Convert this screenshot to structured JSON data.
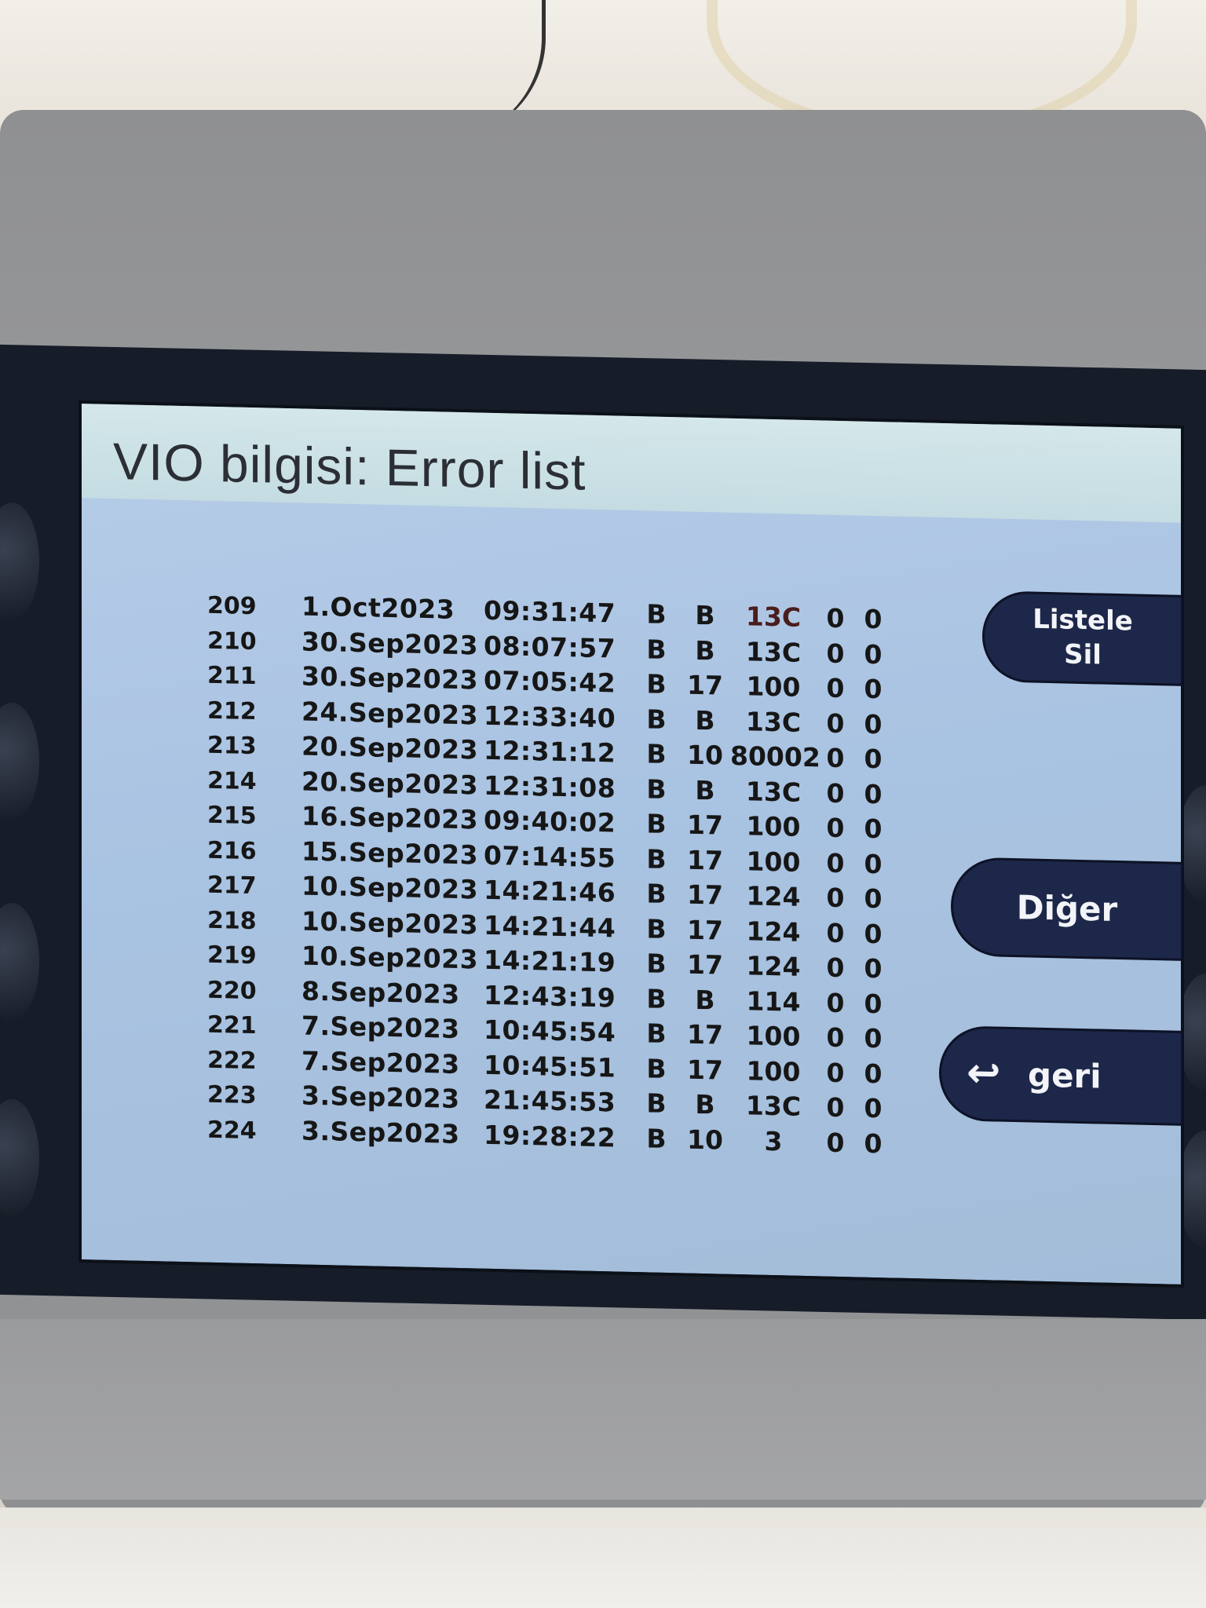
{
  "screen": {
    "title": "VIO bilgisi: Error list"
  },
  "softkeys": {
    "clear_list_line1": "Listele",
    "clear_list_line2": "Sil",
    "other": "Diğer",
    "back": "geri",
    "back_icon": "return-arrow-icon"
  },
  "error_list": {
    "rows": [
      {
        "num": "209",
        "date": "1.Oct2023",
        "time": "09:31:47",
        "f1": "B",
        "f2": "B",
        "f3": "13C",
        "f4": "0",
        "f5": "0"
      },
      {
        "num": "210",
        "date": "30.Sep2023",
        "time": "08:07:57",
        "f1": "B",
        "f2": "B",
        "f3": "13C",
        "f4": "0",
        "f5": "0"
      },
      {
        "num": "211",
        "date": "30.Sep2023",
        "time": "07:05:42",
        "f1": "B",
        "f2": "17",
        "f3": "100",
        "f4": "0",
        "f5": "0"
      },
      {
        "num": "212",
        "date": "24.Sep2023",
        "time": "12:33:40",
        "f1": "B",
        "f2": "B",
        "f3": "13C",
        "f4": "0",
        "f5": "0"
      },
      {
        "num": "213",
        "date": "20.Sep2023",
        "time": "12:31:12",
        "f1": "B",
        "f2": "10",
        "f3": "80002",
        "f4": "0",
        "f5": "0"
      },
      {
        "num": "214",
        "date": "20.Sep2023",
        "time": "12:31:08",
        "f1": "B",
        "f2": "B",
        "f3": "13C",
        "f4": "0",
        "f5": "0"
      },
      {
        "num": "215",
        "date": "16.Sep2023",
        "time": "09:40:02",
        "f1": "B",
        "f2": "17",
        "f3": "100",
        "f4": "0",
        "f5": "0"
      },
      {
        "num": "216",
        "date": "15.Sep2023",
        "time": "07:14:55",
        "f1": "B",
        "f2": "17",
        "f3": "100",
        "f4": "0",
        "f5": "0"
      },
      {
        "num": "217",
        "date": "10.Sep2023",
        "time": "14:21:46",
        "f1": "B",
        "f2": "17",
        "f3": "124",
        "f4": "0",
        "f5": "0"
      },
      {
        "num": "218",
        "date": "10.Sep2023",
        "time": "14:21:44",
        "f1": "B",
        "f2": "17",
        "f3": "124",
        "f4": "0",
        "f5": "0"
      },
      {
        "num": "219",
        "date": "10.Sep2023",
        "time": "14:21:19",
        "f1": "B",
        "f2": "17",
        "f3": "124",
        "f4": "0",
        "f5": "0"
      },
      {
        "num": "220",
        "date": "8.Sep2023",
        "time": "12:43:19",
        "f1": "B",
        "f2": "B",
        "f3": "114",
        "f4": "0",
        "f5": "0"
      },
      {
        "num": "221",
        "date": "7.Sep2023",
        "time": "10:45:54",
        "f1": "B",
        "f2": "17",
        "f3": "100",
        "f4": "0",
        "f5": "0"
      },
      {
        "num": "222",
        "date": "7.Sep2023",
        "time": "10:45:51",
        "f1": "B",
        "f2": "17",
        "f3": "100",
        "f4": "0",
        "f5": "0"
      },
      {
        "num": "223",
        "date": "3.Sep2023",
        "time": "21:45:53",
        "f1": "B",
        "f2": "B",
        "f3": "13C",
        "f4": "0",
        "f5": "0"
      },
      {
        "num": "224",
        "date": "3.Sep2023",
        "time": "19:28:22",
        "f1": "B",
        "f2": "10",
        "f3": "3",
        "f4": "0",
        "f5": "0"
      }
    ]
  },
  "colors": {
    "screen_bg": "#a9c3e2",
    "title_bar_bg": "#c9e0e4",
    "softkey_bg": "#1d2749",
    "text": "#161616"
  }
}
